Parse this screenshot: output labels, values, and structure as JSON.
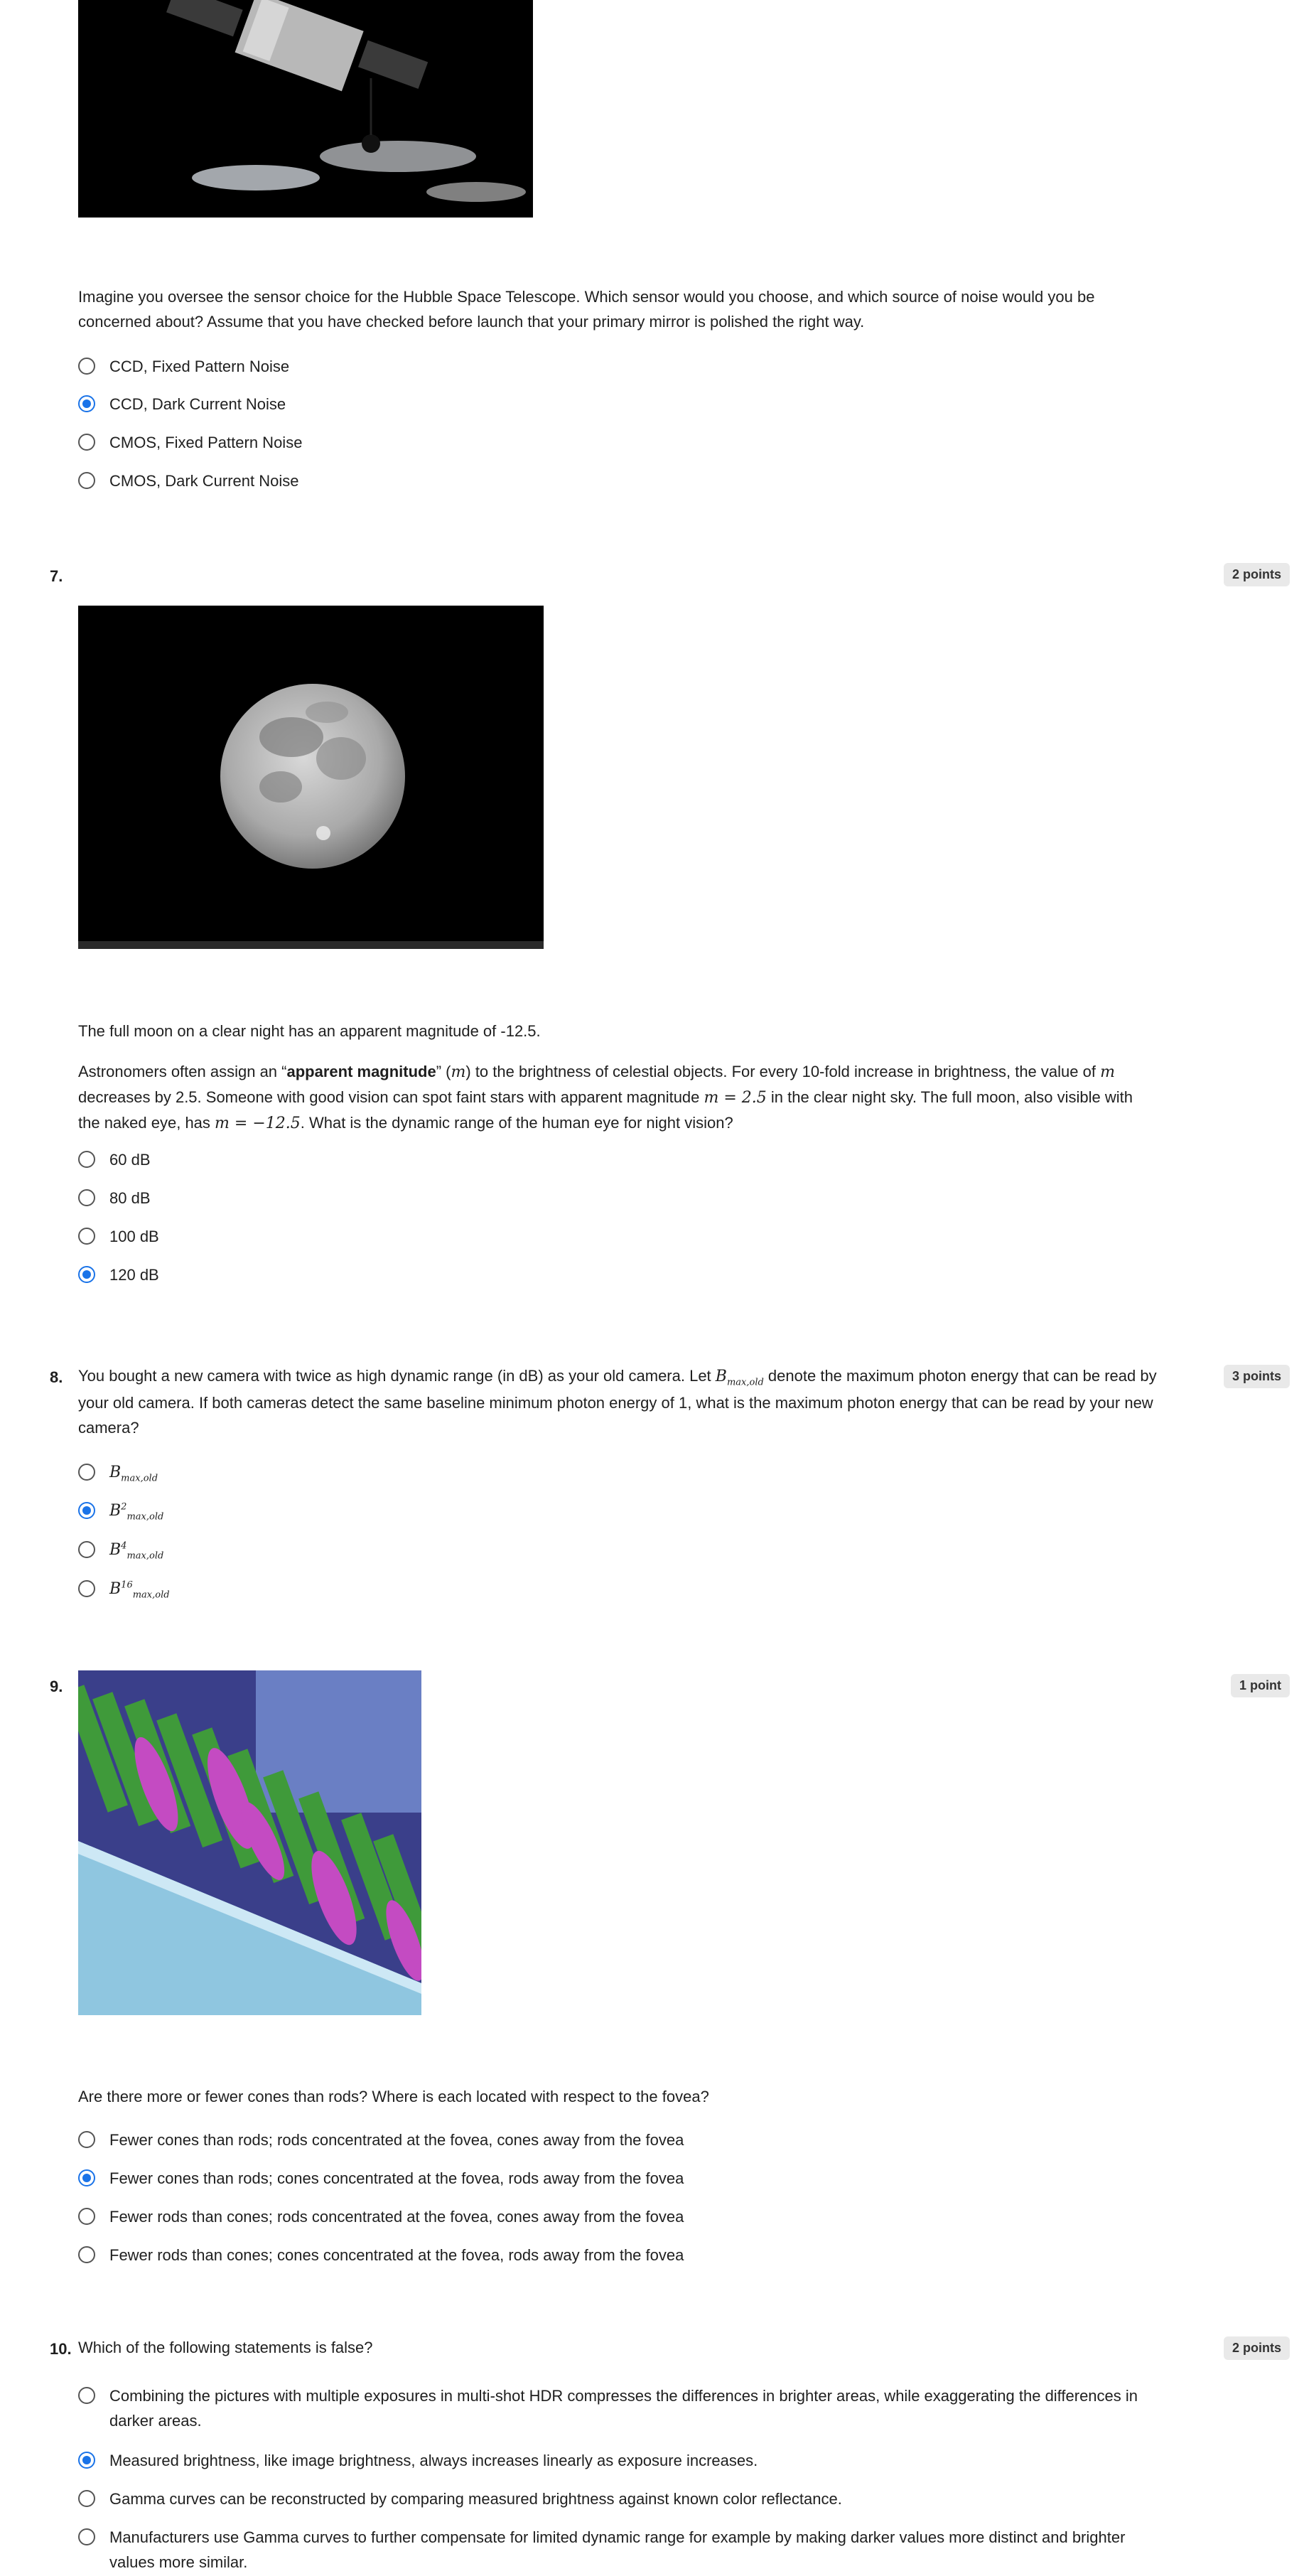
{
  "q6": {
    "prompt": "Imagine you oversee the sensor choice for the Hubble Space Telescope. Which sensor would you choose, and which source of noise would you be concerned about? Assume that you have checked before launch that your primary mirror is polished the right way.",
    "options": [
      "CCD, Fixed Pattern Noise",
      "CCD, Dark Current Noise",
      "CMOS, Fixed Pattern Noise",
      "CMOS, Dark Current Noise"
    ]
  },
  "q7": {
    "number": "7.",
    "points": "2 points",
    "line1": "The full moon on a clear night has an apparent magnitude of -12.5.",
    "p_a": "Astronomers often assign an “",
    "p_bold": "apparent magnitude",
    "p_b": "” (",
    "p_m1": "m",
    "p_c": ") to the brightness of celestial objects. For every 10-fold increase in brightness, the value of ",
    "p_m2": "m",
    "p_d": " decreases by 2.5. Someone with good vision can spot faint stars with apparent magnitude ",
    "p_m3": "m = 2.5",
    "p_e": " in the clear night sky. The full moon, also visible with the naked eye, has ",
    "p_m4": "m = −12.5",
    "p_f": ". What is the dynamic range of the human eye for night vision?",
    "options": [
      "60 dB",
      "80 dB",
      "100 dB",
      "120 dB"
    ]
  },
  "q8": {
    "number": "8.",
    "points": "3 points",
    "p_a": "You bought a new camera with twice as high dynamic range (in dB) as your old camera. Let ",
    "p_B": "B",
    "p_sub": "max,old",
    "p_b": " denote the maximum photon energy that can be read by your old camera. If both cameras detect the same baseline minimum photon energy of 1, what is the maximum photon energy that can be read by your new camera?",
    "opt_base": "B",
    "opt_sub": "max,old",
    "opt_sups": [
      "",
      "2",
      "4",
      "16"
    ]
  },
  "q9": {
    "number": "9.",
    "points": "1 point",
    "prompt": "Are there more or fewer cones than rods? Where is each located with respect to the fovea?",
    "options": [
      "Fewer cones than rods; rods concentrated at the fovea, cones away from the fovea",
      "Fewer cones than rods; cones concentrated at the fovea, rods away from the fovea",
      "Fewer rods than cones; rods concentrated at the fovea, cones away from the fovea",
      "Fewer rods than cones; cones concentrated at the fovea, rods away from the fovea"
    ]
  },
  "q10": {
    "number": "10.",
    "points": "2 points",
    "prompt": "Which of the following statements is false?",
    "options": [
      "Combining the pictures with multiple exposures in multi-shot HDR compresses the differences in brighter areas, while exaggerating the differences in darker areas.",
      "Measured brightness, like image brightness, always increases linearly as exposure increases.",
      "Gamma curves can be reconstructed by comparing measured brightness against known color reflectance.",
      "Manufacturers use Gamma curves to further compensate for limited dynamic range for example by making darker values more distinct and brighter values more similar."
    ]
  },
  "colors": {
    "accent": "#1a73e8",
    "badge_bg": "#e9e9e9"
  }
}
